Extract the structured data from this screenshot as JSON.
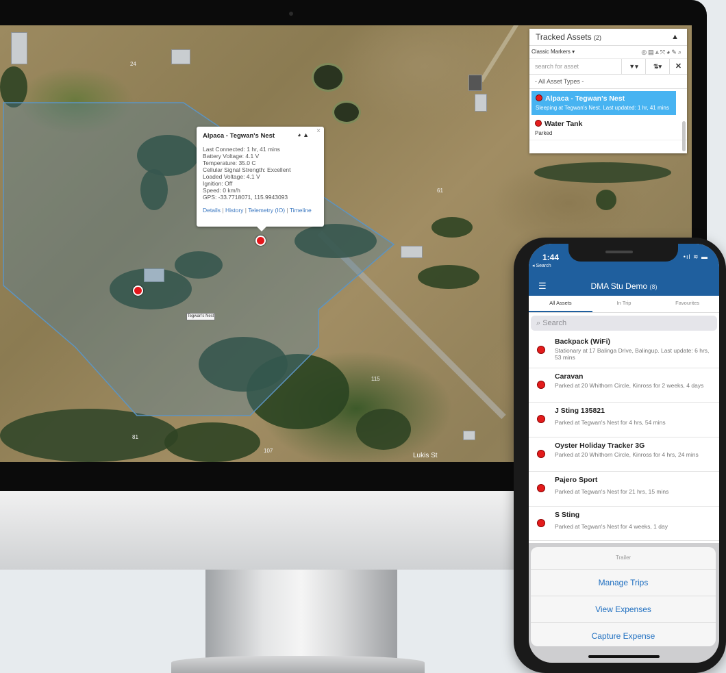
{
  "map": {
    "street_label": "Lukis St",
    "poi_label": "Tegwan's Nest",
    "road_numbers": [
      "24",
      "61",
      "115",
      "81",
      "107"
    ],
    "colors": {
      "geofence": "#4a7ea8",
      "marker": "#e4161b"
    }
  },
  "popup": {
    "title": "Alpaca - Tegwan's Nest",
    "tools_icons": [
      "globe-icon",
      "bell-icon"
    ],
    "close": "×",
    "lines": [
      "Last Connected: 1 hr, 41 mins",
      "Battery Voltage: 4.1 V",
      "Temperature: 35.0 C",
      "Cellular Signal Strength: Excellent",
      "Loaded Voltage: 4.1 V",
      "Ignition: Off",
      "Speed: 0 km/h",
      "GPS: -33.7718071, 115.9943093"
    ],
    "links": [
      "Details",
      "History",
      "Telemetry (IO)",
      "Timeline"
    ]
  },
  "panel": {
    "title": "Tracked Assets",
    "count": "(2)",
    "marker_style": "Classic Markers ▾",
    "search_placeholder": "search for asset",
    "filter_label": "▼▾",
    "sort_label": "⇅▾",
    "clear_label": "✕",
    "type_select": "- All Asset Types -",
    "assets": [
      {
        "name": "Alpaca - Tegwan's Nest",
        "status": "Sleeping at Tegwan's Nest. Last updated: 1 hr, 41 mins",
        "selected": true
      },
      {
        "name": "Water Tank",
        "status": "Parked",
        "selected": false
      }
    ],
    "accent": "#47b3f1"
  },
  "phone": {
    "time": "1:44",
    "back_label": "◂ Search",
    "signal": "•ıl ≋ ▬",
    "title": "DMA Stu Demo",
    "count": "(8)",
    "tabs": [
      "All Assets",
      "In Trip",
      "Favourites"
    ],
    "search_placeholder": "Search",
    "assets": [
      {
        "name": "Backpack (WiFi)",
        "status": "Stationary at 17 Balinga Drive, Balingup. Last update: 6 hrs, 53 mins"
      },
      {
        "name": "Caravan",
        "status": "Parked at 20 Whithorn Circle, Kinross for 2 weeks, 4 days"
      },
      {
        "name": "J Sting 135821",
        "status": "Parked at Tegwan's Nest for 4 hrs, 54 mins"
      },
      {
        "name": "Oyster Holiday Tracker 3G",
        "status": "Parked at 20 Whithorn Circle, Kinross for 4 hrs, 24 mins"
      },
      {
        "name": "Pajero Sport",
        "status": "Parked at Tegwan's Nest for 21 hrs, 15 mins"
      },
      {
        "name": "S Sting",
        "status": "Parked at Tegwan's Nest for 4 weeks, 1 day"
      }
    ],
    "sheet": {
      "title": "Trailer",
      "actions": [
        "Manage Trips",
        "View Expenses",
        "Capture Expense"
      ]
    },
    "brand_color": "#1f5f9e"
  }
}
